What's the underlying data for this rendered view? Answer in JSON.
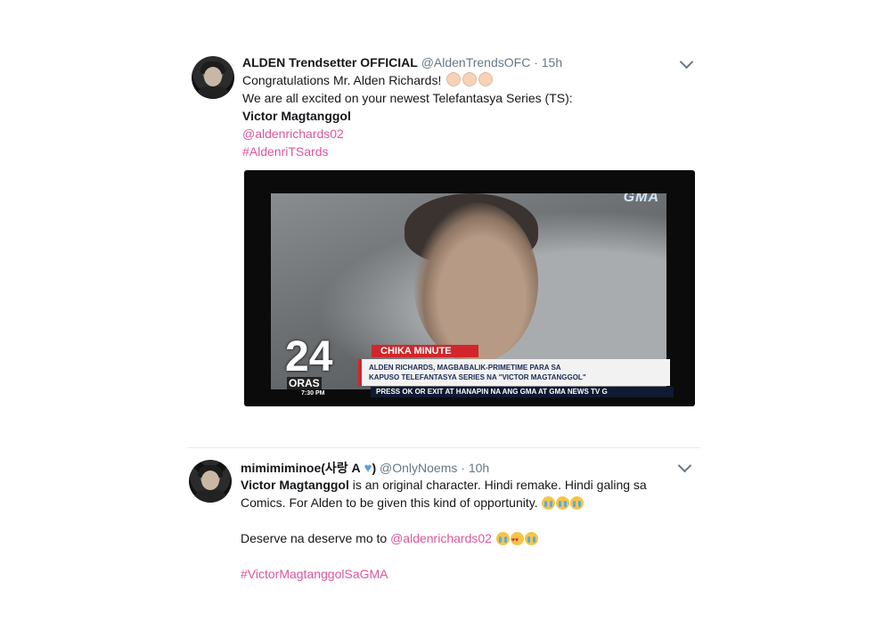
{
  "tweet1": {
    "display_name": "ALDEN Trendsetter OFFICIAL",
    "handle": "@AldenTrendsOFC",
    "separator": "·",
    "time": "15h",
    "line1": "Congratulations Mr. Alden Richards!",
    "line2": "We are all excited on your newest Telefantasya Series (TS):",
    "line3": "Victor Magtanggol",
    "mention": "@aldenrichards02",
    "hashtag": "#AldenriTSards",
    "media": {
      "logo": "GMA",
      "big_number": "24",
      "oras": "ORAS",
      "time_label": "7:30 PM",
      "segment": "CHIKA MINUTE",
      "headline1": "ALDEN RICHARDS, MAGBABALIK-PRIMETIME PARA SA",
      "headline2": "KAPUSO TELEFANTASYA SERIES NA \"VICTOR MAGTANGGOL\"",
      "ticker": "PRESS OK OR EXIT AT HANAPIN NA ANG GMA AT GMA NEWS TV G"
    }
  },
  "tweet2": {
    "display_name": "mimimiminoe(사랑 A",
    "display_name_end": ")",
    "handle": "@OnlyNoems",
    "separator": "·",
    "time": "10h",
    "line1_bold": "Victor Magtanggol",
    "line1_rest": " is an original character. Hindi remake. Hindi galing sa",
    "line2": "Comics. For Alden to be given this kind of opportunity.",
    "line3_text": "Deserve na deserve mo to ",
    "mention": "@aldenrichards02",
    "hashtag": "#VictorMagtanggolSaGMA"
  },
  "icons": [
    "avatar-icon",
    "chevron-down-icon",
    "clap-emoji",
    "crying-face-emoji",
    "heart-eyes-emoji",
    "blue-heart-emoji"
  ],
  "colors": {
    "link": "#e0559b",
    "muted": "#657786",
    "text": "#14171a"
  }
}
